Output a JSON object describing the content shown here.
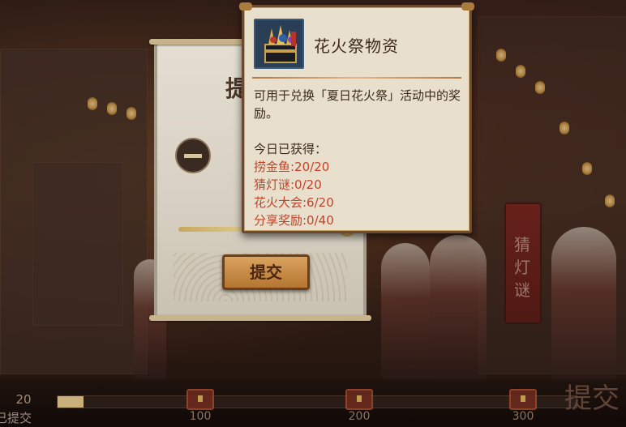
{
  "scroll": {
    "title_fragment": "提",
    "submit_label": "提交"
  },
  "tooltip": {
    "item_name": "花火祭物资",
    "description": "可用于兑换「夏日花火祭」活动中的奖励。",
    "today_label": "今日已获得：",
    "stats": [
      "捞金鱼:20/20",
      "猜灯谜:0/20",
      "花火大会:6/20",
      "分享奖励:0/40"
    ],
    "stat_color": "#c0442a"
  },
  "progress": {
    "submitted_count": "20",
    "submitted_label": "已提交",
    "fill_fraction": 0.05,
    "milestones": [
      "100",
      "200",
      "300"
    ]
  },
  "side_banner": {
    "text": "猜灯谜"
  },
  "corner_text": "提交"
}
